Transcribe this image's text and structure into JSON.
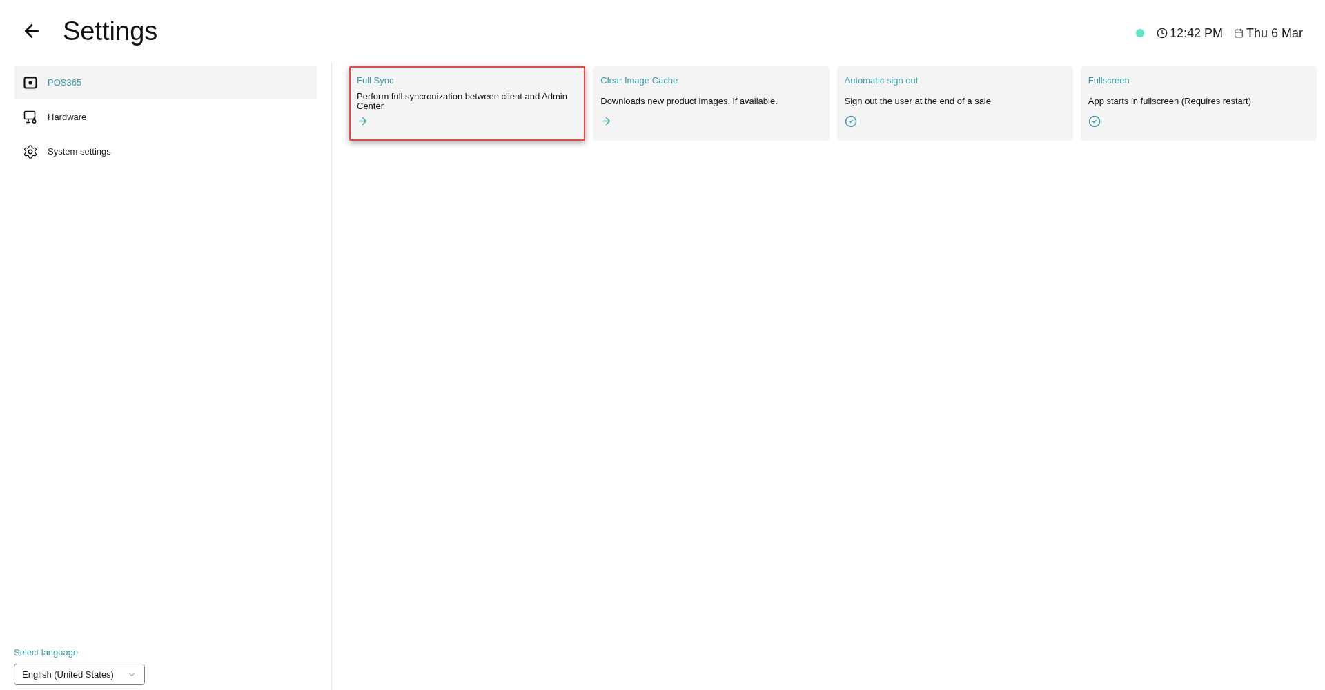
{
  "header": {
    "title": "Settings",
    "status": {
      "connected": true
    },
    "time": "12:42 PM",
    "date": "Thu 6 Mar"
  },
  "sidebar": {
    "items": [
      {
        "label": "POS365",
        "selected": true
      },
      {
        "label": "Hardware",
        "selected": false
      },
      {
        "label": "System settings",
        "selected": false
      }
    ],
    "language": {
      "label": "Select language",
      "value": "English (United States)"
    }
  },
  "cards": [
    {
      "kind": "action",
      "title": "Full Sync",
      "description": "Perform full syncronization between client and Admin Center",
      "highlighted": true
    },
    {
      "kind": "action",
      "title": "Clear Image Cache",
      "description": "Downloads new product images, if available.",
      "highlighted": false
    },
    {
      "kind": "toggle",
      "title": "Automatic sign out",
      "description": "Sign out the user at the end of a sale",
      "on": true,
      "highlighted": false
    },
    {
      "kind": "toggle",
      "title": "Fullscreen",
      "description": "App starts in fullscreen (Requires restart)",
      "on": true,
      "highlighted": false
    }
  ]
}
